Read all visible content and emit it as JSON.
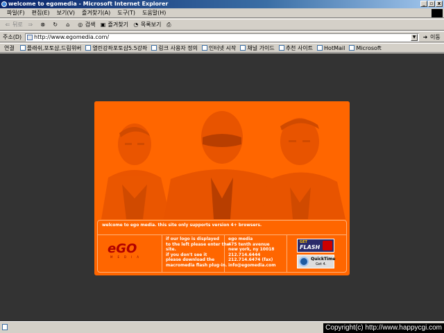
{
  "window": {
    "title": "welcome to egomedia - Microsoft Internet Explorer",
    "buttons": [
      "_",
      "▫",
      "x"
    ]
  },
  "menu": [
    "파일(F)",
    "편집(E)",
    "보기(V)",
    "즐겨찾기(A)",
    "도구(T)",
    "도움말(H)"
  ],
  "toolbar": {
    "back": "뒤로",
    "search": "검색",
    "favorites": "즐겨찾기",
    "history": "목록보기"
  },
  "address": {
    "label": "주소(D)",
    "url": "http://www.egomedia.com/",
    "go": "이동"
  },
  "links": {
    "label": "연결",
    "items": [
      "플래쉬,포토샵,드림위버",
      "열린강좌포토샵5.5강좌",
      "링크 사용자 정의",
      "인터넷 시작",
      "채널 가이드",
      "추천 사이트",
      "HotMail",
      "Microsoft"
    ]
  },
  "page": {
    "welcome": "welcome to ego media. this site only supports version 4+ browsers.",
    "logo": "eGO",
    "logo_sub": "MEDIA",
    "notice": [
      "if our logo is displayed",
      "to the left please enter the",
      "site.",
      "if you don't see it",
      "please download the",
      "macromedia flash plug-in."
    ],
    "contact": [
      "ego media",
      "475 tenth avenue",
      "new york, ny 10018",
      "212.714.6444",
      "212.714.6474 (fax)",
      "info@egomedia.com"
    ],
    "flash_badge": {
      "top": "GET",
      "main": "FLASH"
    },
    "quicktime_badge": {
      "main": "QuickTime",
      "sub": "Get 4."
    }
  },
  "status": {
    "copyright": "Copyright(c) http://www.happycgi.com"
  },
  "colors": {
    "content_bg": "#333333",
    "panel": "#ff6600",
    "logo_red": "#b00000"
  }
}
